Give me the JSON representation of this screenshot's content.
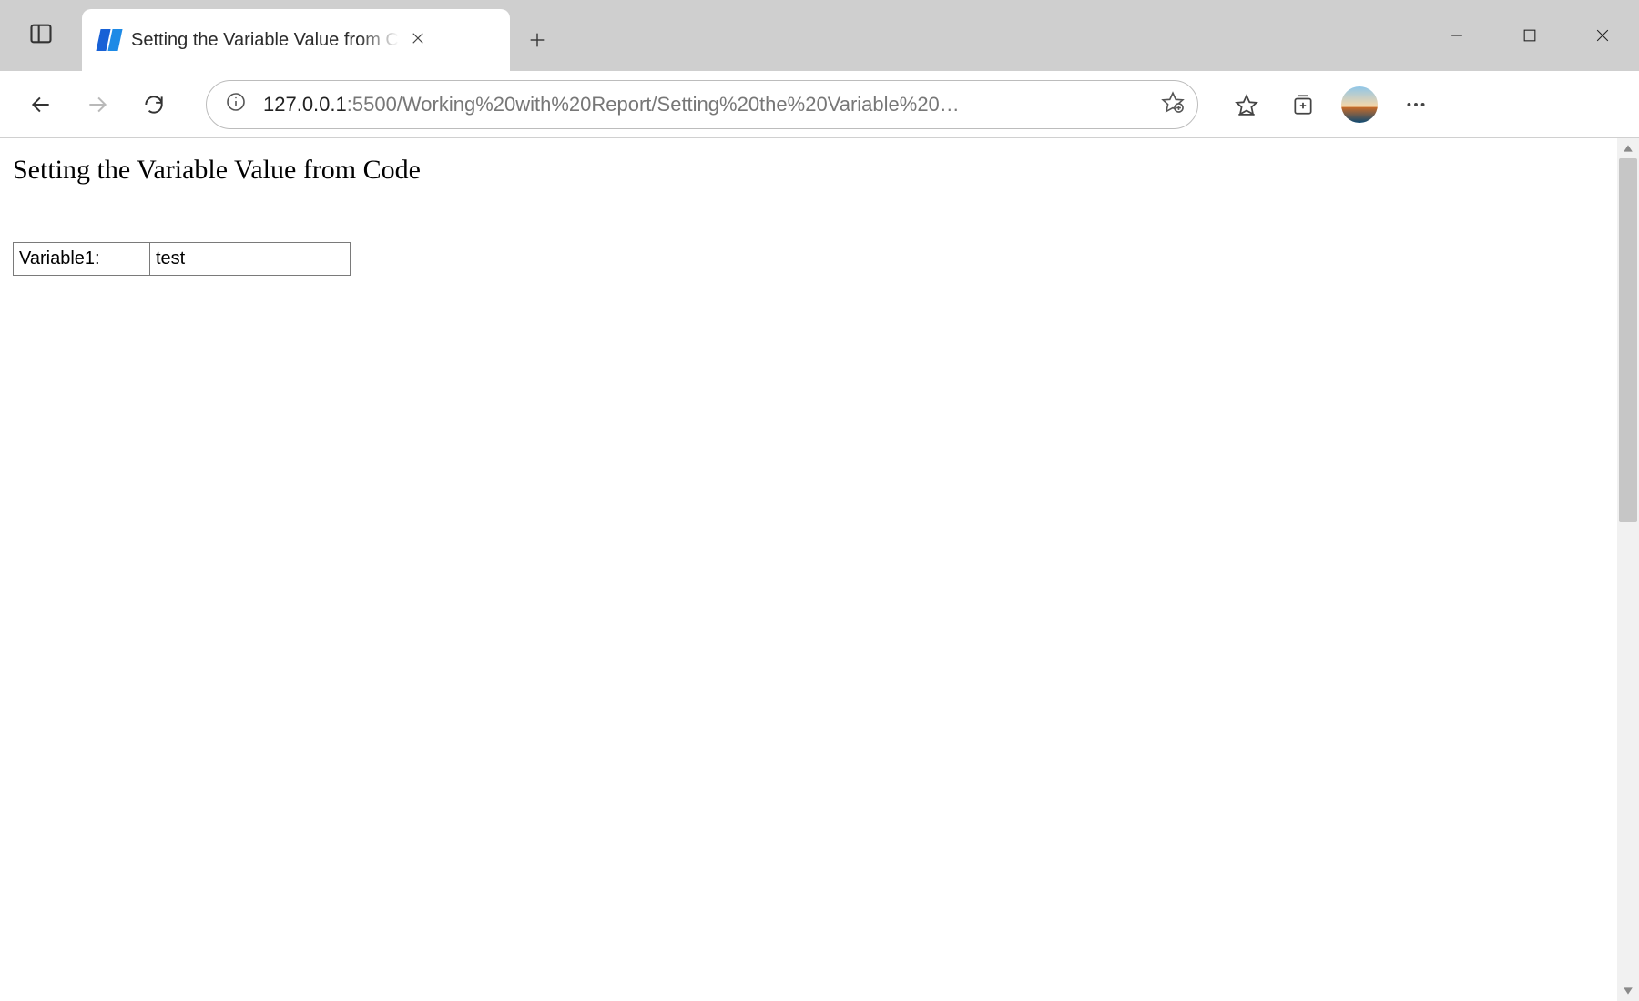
{
  "tab": {
    "title": "Setting the Variable Value from C"
  },
  "address": {
    "host": "127.0.0.1",
    "port_and_path": ":5500/Working%20with%20Report/Setting%20the%20Variable%20…"
  },
  "page": {
    "heading": "Setting the Variable Value from Code",
    "table": {
      "label": "Variable1:",
      "value": "test"
    }
  }
}
